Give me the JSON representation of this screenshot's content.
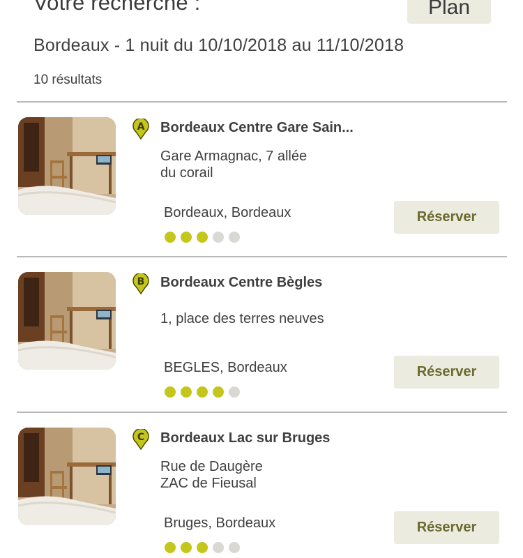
{
  "header": {
    "title": "Votre recherche :",
    "plan_label": "Plan"
  },
  "search": {
    "summary": "Bordeaux - 1 nuit du 10/10/2018 au 11/10/2018",
    "results_count": "10 résultats"
  },
  "colors": {
    "rating_on": "#c4c61c",
    "rating_off": "#d9d8d3",
    "button_bg": "#ecebe0",
    "marker": "#c4c61c"
  },
  "hotels": [
    {
      "marker": "A",
      "name": "Bordeaux Centre Gare Sain...",
      "address": [
        "Gare Armagnac, 7 allée",
        "du corail"
      ],
      "city": "Bordeaux, Bordeaux",
      "rating": 3,
      "rating_max": 5,
      "reserve_label": "Réserver",
      "image": "hotel-room-photo"
    },
    {
      "marker": "B",
      "name": "Bordeaux Centre Bègles",
      "address": [
        "",
        "1, place des terres neuves"
      ],
      "city": "BEGLES, Bordeaux",
      "rating": 4,
      "rating_max": 5,
      "reserve_label": "Réserver",
      "image": "hotel-room-photo"
    },
    {
      "marker": "C",
      "name": "Bordeaux Lac sur Bruges",
      "address": [
        "Rue de Daugère",
        "ZAC de Fieusal"
      ],
      "city": "Bruges, Bordeaux",
      "rating": 3,
      "rating_max": 5,
      "reserve_label": "Réserver",
      "image": "hotel-room-photo"
    }
  ]
}
